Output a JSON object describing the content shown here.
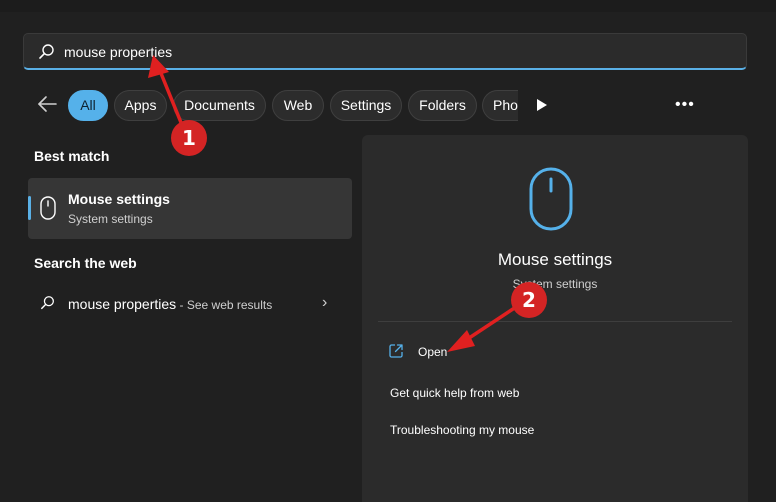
{
  "search": {
    "query": "mouse properties"
  },
  "filters": [
    {
      "label": "All",
      "active": true
    },
    {
      "label": "Apps"
    },
    {
      "label": "Documents"
    },
    {
      "label": "Web"
    },
    {
      "label": "Settings"
    },
    {
      "label": "Folders"
    },
    {
      "label": "Pho"
    }
  ],
  "more_label": "•••",
  "best_match": {
    "heading": "Best match",
    "title": "Mouse settings",
    "subtitle": "System settings"
  },
  "web": {
    "heading": "Search the web",
    "query": "mouse properties",
    "hint": " - See web results",
    "chevron": "›"
  },
  "detail": {
    "title": "Mouse settings",
    "subtitle": "System settings",
    "open_label": "Open",
    "actions": [
      "Get quick help from web",
      "Troubleshooting my mouse"
    ]
  },
  "annotations": [
    {
      "label": "1"
    },
    {
      "label": "2"
    }
  ],
  "colors": {
    "accent": "#55b1ea",
    "background": "#202020",
    "panel": "#2b2b2b",
    "annotation": "#d42424"
  },
  "icons": [
    "search-icon",
    "back-arrow-icon",
    "play-icon",
    "more-icon",
    "mouse-icon",
    "chevron-right-icon",
    "open-external-icon"
  ]
}
